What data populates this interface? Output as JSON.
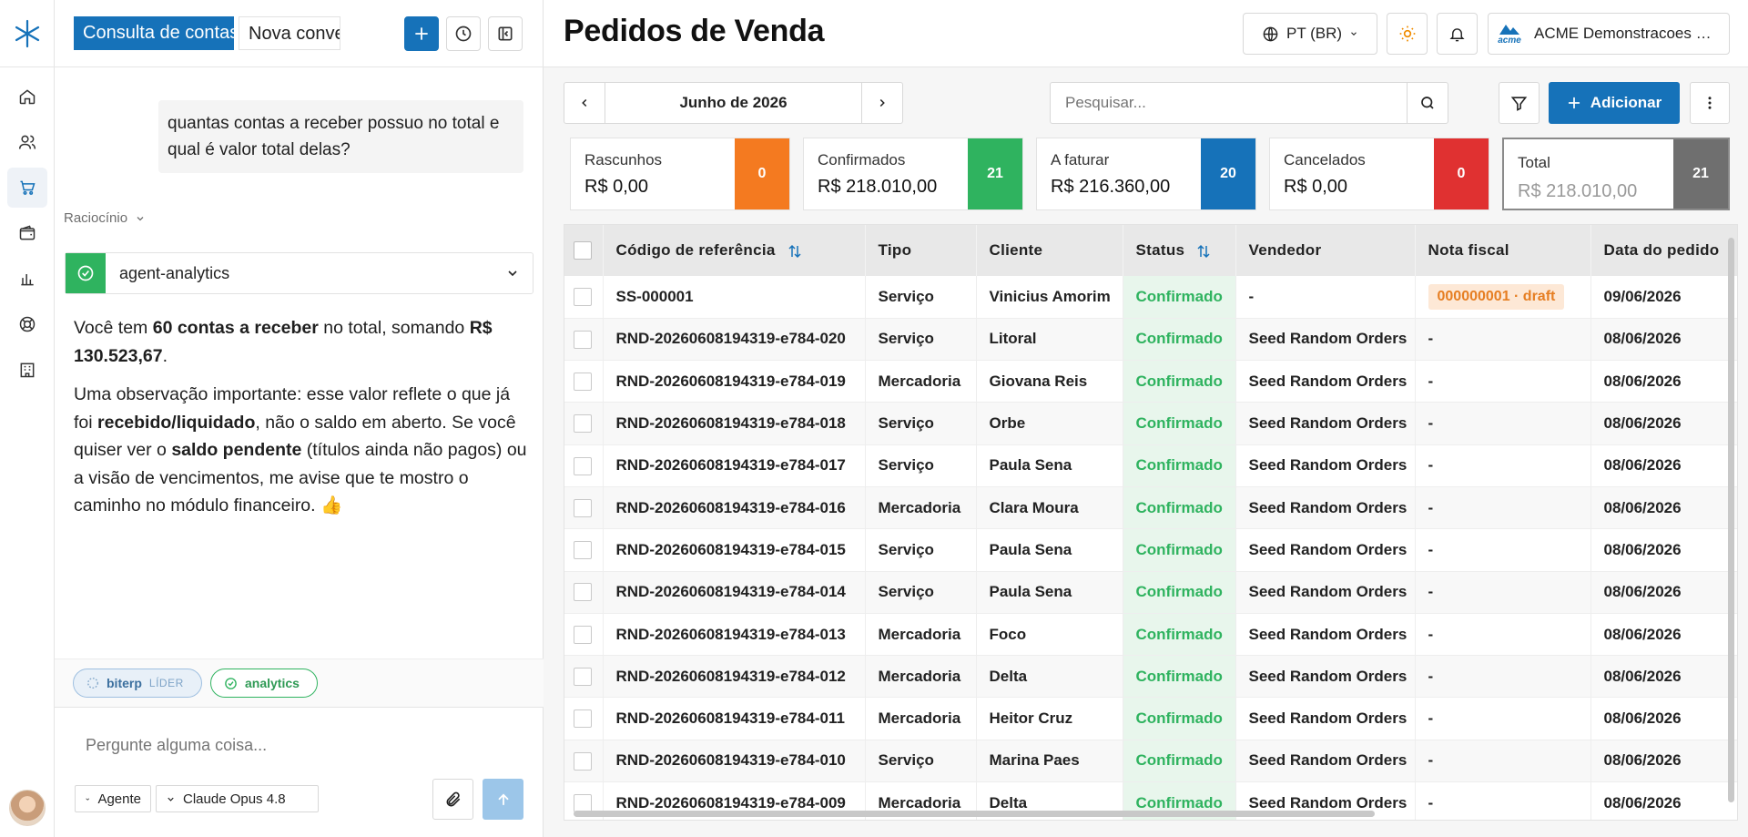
{
  "chat": {
    "tab_active": "Consulta de contas",
    "tab_new": "Nova conversa",
    "user_message": "quantas contas a receber possuo no total e qual é valor total delas?",
    "reasoning_label": "Raciocínio",
    "agent_name": "agent-analytics",
    "answer": {
      "p1_a": "Você tem ",
      "p1_b": "60 contas a receber",
      "p1_c": " no total, somando ",
      "p1_d": "R$ 130.523,67",
      "p1_e": ".",
      "p2_a": "Uma observação importante: esse valor reflete o que já foi ",
      "p2_b": "recebido/liquidado",
      "p2_c": ", não o saldo em aberto. Se você quiser ver o ",
      "p2_d": "saldo pendente",
      "p2_e": " (títulos ainda não pagos) ou a visão de vencimentos, me avise que te mostro o caminho no módulo financeiro. 👍"
    },
    "chips": {
      "biterp": "biterp",
      "biterp_tag": "LÍDER",
      "analytics": "analytics"
    },
    "input_placeholder": "Pergunte alguma coisa...",
    "mode_select": "Agente",
    "model_select": "Claude Opus 4.8"
  },
  "header": {
    "title": "Pedidos de Venda",
    "language": "PT (BR)",
    "company_logo": "acme",
    "company": "ACME Demonstracoes Ltda"
  },
  "toolbar": {
    "month": "Junho de 2026",
    "search_placeholder": "Pesquisar...",
    "add_label": "Adicionar"
  },
  "cards": [
    {
      "title": "Rascunhos",
      "value": "R$ 0,00",
      "count": "0",
      "color": "#f47a20"
    },
    {
      "title": "Confirmados",
      "value": "R$ 218.010,00",
      "count": "21",
      "color": "#2fb35f"
    },
    {
      "title": "A faturar",
      "value": "R$ 216.360,00",
      "count": "20",
      "color": "#1672b9"
    },
    {
      "title": "Cancelados",
      "value": "R$ 0,00",
      "count": "0",
      "color": "#e03131"
    },
    {
      "title": "Total",
      "value": "R$ 218.010,00",
      "count": "21",
      "color": "#6f6f6f"
    }
  ],
  "table": {
    "columns": [
      "Código de referência",
      "Tipo",
      "Cliente",
      "Status",
      "Vendedor",
      "Nota fiscal",
      "Data do pedido"
    ],
    "rows": [
      {
        "ref": "SS-000001",
        "tipo": "Serviço",
        "cliente": "Vinicius Amorim",
        "status": "Confirmado",
        "vendedor": "-",
        "nf": "000000001 · draft",
        "data": "09/06/2026"
      },
      {
        "ref": "RND-20260608194319-e784-020",
        "tipo": "Serviço",
        "cliente": "Litoral",
        "status": "Confirmado",
        "vendedor": "Seed Random Orders",
        "nf": "-",
        "data": "08/06/2026"
      },
      {
        "ref": "RND-20260608194319-e784-019",
        "tipo": "Mercadoria",
        "cliente": "Giovana Reis",
        "status": "Confirmado",
        "vendedor": "Seed Random Orders",
        "nf": "-",
        "data": "08/06/2026"
      },
      {
        "ref": "RND-20260608194319-e784-018",
        "tipo": "Serviço",
        "cliente": "Orbe",
        "status": "Confirmado",
        "vendedor": "Seed Random Orders",
        "nf": "-",
        "data": "08/06/2026"
      },
      {
        "ref": "RND-20260608194319-e784-017",
        "tipo": "Serviço",
        "cliente": "Paula Sena",
        "status": "Confirmado",
        "vendedor": "Seed Random Orders",
        "nf": "-",
        "data": "08/06/2026"
      },
      {
        "ref": "RND-20260608194319-e784-016",
        "tipo": "Mercadoria",
        "cliente": "Clara Moura",
        "status": "Confirmado",
        "vendedor": "Seed Random Orders",
        "nf": "-",
        "data": "08/06/2026"
      },
      {
        "ref": "RND-20260608194319-e784-015",
        "tipo": "Serviço",
        "cliente": "Paula Sena",
        "status": "Confirmado",
        "vendedor": "Seed Random Orders",
        "nf": "-",
        "data": "08/06/2026"
      },
      {
        "ref": "RND-20260608194319-e784-014",
        "tipo": "Serviço",
        "cliente": "Paula Sena",
        "status": "Confirmado",
        "vendedor": "Seed Random Orders",
        "nf": "-",
        "data": "08/06/2026"
      },
      {
        "ref": "RND-20260608194319-e784-013",
        "tipo": "Mercadoria",
        "cliente": "Foco",
        "status": "Confirmado",
        "vendedor": "Seed Random Orders",
        "nf": "-",
        "data": "08/06/2026"
      },
      {
        "ref": "RND-20260608194319-e784-012",
        "tipo": "Mercadoria",
        "cliente": "Delta",
        "status": "Confirmado",
        "vendedor": "Seed Random Orders",
        "nf": "-",
        "data": "08/06/2026"
      },
      {
        "ref": "RND-20260608194319-e784-011",
        "tipo": "Mercadoria",
        "cliente": "Heitor Cruz",
        "status": "Confirmado",
        "vendedor": "Seed Random Orders",
        "nf": "-",
        "data": "08/06/2026"
      },
      {
        "ref": "RND-20260608194319-e784-010",
        "tipo": "Serviço",
        "cliente": "Marina Paes",
        "status": "Confirmado",
        "vendedor": "Seed Random Orders",
        "nf": "-",
        "data": "08/06/2026"
      },
      {
        "ref": "RND-20260608194319-e784-009",
        "tipo": "Mercadoria",
        "cliente": "Delta",
        "status": "Confirmado",
        "vendedor": "Seed Random Orders",
        "nf": "-",
        "data": "08/06/2026"
      }
    ]
  },
  "colors": {
    "primary": "#1672b9",
    "success": "#2fb35f",
    "warning_bg": "#fde8d6",
    "warning_fg": "#e67e22"
  }
}
